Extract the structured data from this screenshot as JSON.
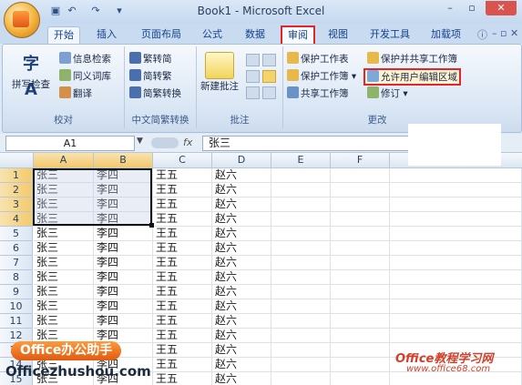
{
  "window": {
    "title": "Book1 - Microsoft Excel",
    "controls": [
      "–",
      "▫",
      "✕"
    ]
  },
  "quick_access": [
    "save-icon",
    "undo-icon",
    "redo-icon",
    "customize-icon"
  ],
  "tabs": [
    "开始",
    "插入",
    "页面布局",
    "公式",
    "数据",
    "审阅",
    "视图",
    "开发工具",
    "加载项"
  ],
  "active_tab": "审阅",
  "ribbon": {
    "proofing": {
      "label": "校对",
      "spelling": "拼写检查",
      "research": "信息检索",
      "thesaurus": "同义词库",
      "translate": "翻译"
    },
    "chinese_conversion": {
      "label": "中文简繁转换",
      "to_simplified": "繁转简",
      "to_traditional": "简转繁",
      "convert": "简繁转换"
    },
    "comments": {
      "label": "批注",
      "new_comment": "新建批注"
    },
    "changes": {
      "label": "更改",
      "protect_sheet": "保护工作表",
      "protect_workbook": "保护工作簿",
      "share_workbook": "共享工作簿",
      "protect_share": "保护并共享工作簿",
      "allow_users_edit": "允许用户编辑区域",
      "track_changes": "修订"
    }
  },
  "formula_bar": {
    "name_box": "A1",
    "fx": "fx",
    "value": "张三"
  },
  "sheet": {
    "columns": [
      "A",
      "B",
      "C",
      "D",
      "E",
      "F"
    ],
    "rows": [
      [
        "张三",
        "李四",
        "王五",
        "赵六"
      ],
      [
        "张三",
        "李四",
        "王五",
        "赵六"
      ],
      [
        "张三",
        "李四",
        "王五",
        "赵六"
      ],
      [
        "张三",
        "李四",
        "王五",
        "赵六"
      ],
      [
        "张三",
        "李四",
        "王五",
        "赵六"
      ],
      [
        "张三",
        "李四",
        "王五",
        "赵六"
      ],
      [
        "张三",
        "李四",
        "王五",
        "赵六"
      ],
      [
        "张三",
        "李四",
        "王五",
        "赵六"
      ],
      [
        "张三",
        "李四",
        "王五",
        "赵六"
      ],
      [
        "张三",
        "李四",
        "王五",
        "赵六"
      ],
      [
        "张三",
        "李四",
        "王五",
        "赵六"
      ],
      [
        "张三",
        "李四",
        "王五",
        "赵六"
      ],
      [
        "张三",
        "李四",
        "王五",
        "赵六"
      ],
      [
        "张三",
        "李四",
        "王五",
        "赵六"
      ],
      [
        "张三",
        "李四",
        "王五",
        "赵六"
      ]
    ],
    "row_numbers": [
      "1",
      "2",
      "3",
      "4",
      "5",
      "6",
      "7",
      "8",
      "9",
      "10",
      "11",
      "12",
      "13",
      "14",
      "15"
    ],
    "selected_range": "A1:B4"
  },
  "watermarks": {
    "left_badge": "Office办公助手",
    "left_url": "Officezhushou.com",
    "right_title": "Office教程学习网",
    "right_url": "www.office68.com"
  },
  "colors": {
    "highlight_red": "#e0262a",
    "selection_header": "#f3c96b",
    "ribbon_blue": "#dbe7f5"
  }
}
